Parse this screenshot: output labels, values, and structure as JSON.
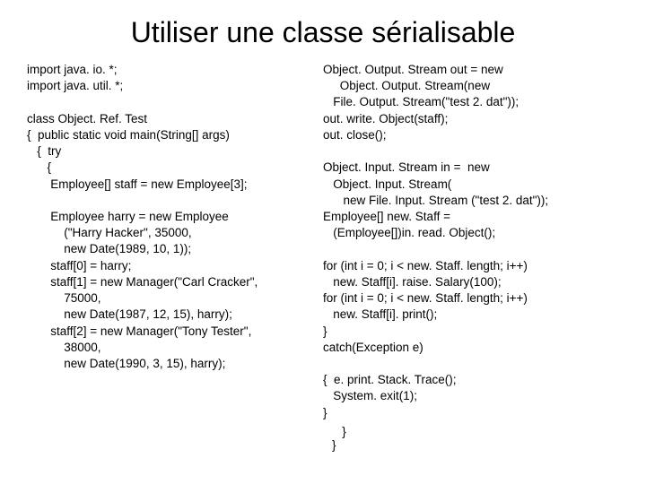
{
  "title": "Utiliser une classe sérialisable",
  "left": {
    "l01": "import java. io. *;",
    "l02": "import java. util. *;",
    "l03": "",
    "l04": "class Object. Ref. Test",
    "l05": "{  public static void main(String[] args)",
    "l06": "   {  try",
    "l07": "      {",
    "l08": "       Employee[] staff = new Employee[3];",
    "l09": "",
    "l10": "       Employee harry = new Employee",
    "l11": "           (\"Harry Hacker\", 35000,",
    "l12": "           new Date(1989, 10, 1));",
    "l13": "       staff[0] = harry;",
    "l14": "       staff[1] = new Manager(\"Carl Cracker\",",
    "l15": "           75000,",
    "l16": "           new Date(1987, 12, 15), harry);",
    "l17": "       staff[2] = new Manager(\"Tony Tester\",",
    "l18": "           38000,",
    "l19": "           new Date(1990, 3, 15), harry);"
  },
  "right": {
    "r01": "Object. Output. Stream out = new",
    "r02": "     Object. Output. Stream(new",
    "r03": "   File. Output. Stream(\"test 2. dat\"));",
    "r04a": "out. ",
    "r04b": "write. Object",
    "r04c": "(staff);",
    "r05": "out. close();",
    "r06": "",
    "r07": "Object. Input. Stream in =  new",
    "r08": "   Object. Input. Stream(",
    "r09": "      new File. Input. Stream (\"test 2. dat\"));",
    "r10": "Employee[] new. Staff =",
    "r11a": "   (Employee[])in. ",
    "r11b": "read. Object",
    "r11c": "();",
    "r12": "",
    "r13": "for (int i = 0; i < new. Staff. length; i++)",
    "r14": "   new. Staff[i]. raise. Salary(100);",
    "r15": "for (int i = 0; i < new. Staff. length; i++)",
    "r16": "   new. Staff[i]. print();",
    "r17": "}",
    "r18": "catch(Exception e)",
    "r19": "",
    "r20": "{  e. print. Stack. Trace();",
    "r21": "   System. exit(1);",
    "r22": "}"
  },
  "closers": {
    "c1": "   }",
    "c2": "}"
  }
}
